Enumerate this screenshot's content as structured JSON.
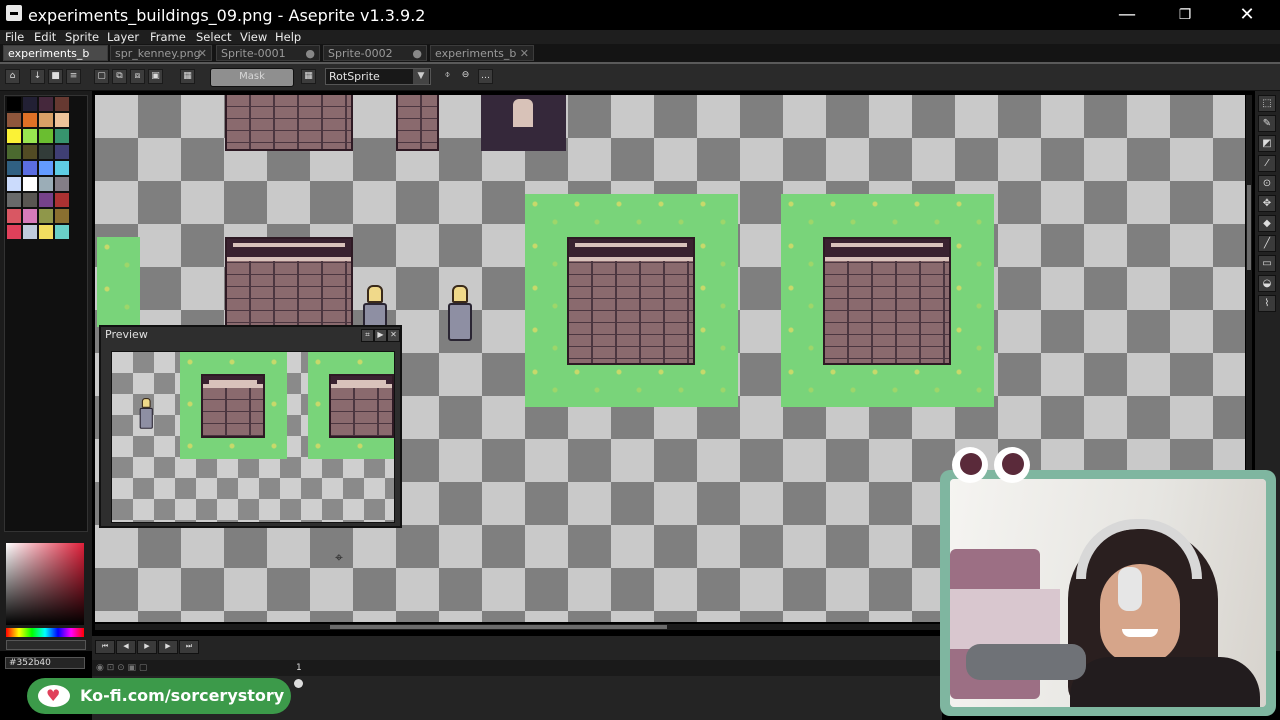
{
  "window": {
    "title": "experiments_buildings_09.png - Aseprite v1.3.9.2",
    "minimize": "—",
    "maximize": "❐",
    "close": "✕"
  },
  "menu": [
    "File",
    "Edit",
    "Sprite",
    "Layer",
    "Frame",
    "Select",
    "View",
    "Help"
  ],
  "tabs": [
    {
      "label": "experiments_b",
      "active": true
    },
    {
      "label": "spr_kenney.png",
      "active": false
    },
    {
      "label": "Sprite-0001",
      "active": false
    },
    {
      "label": "Sprite-0002",
      "active": false
    },
    {
      "label": "experiments_b",
      "active": false
    }
  ],
  "toolbar": {
    "mask_label": "Mask",
    "rotation_algorithm": "RotSprite"
  },
  "preview": {
    "title": "Preview"
  },
  "color": {
    "hex": "#352b40"
  },
  "palette": [
    "#000000",
    "#222034",
    "#45283c",
    "#663931",
    "#8f563b",
    "#df7126",
    "#d9a066",
    "#eec39a",
    "#fbf236",
    "#99e550",
    "#6abe30",
    "#37946e",
    "#4b692f",
    "#524b24",
    "#323c39",
    "#3f3f74",
    "#306082",
    "#5b6ee1",
    "#639bff",
    "#5fcde4",
    "#cbdbfc",
    "#ffffff",
    "#9badb7",
    "#847e87",
    "#696a6a",
    "#595652",
    "#76428a",
    "#ac3232",
    "#d95763",
    "#d77bba",
    "#8f974a",
    "#8a6f30",
    "#e0405a",
    "#c0cbdc",
    "#f2dd60",
    "#6ad0c8"
  ],
  "timeline": {
    "frame_number": "1"
  },
  "overlay": {
    "kofi_text": "Ko-fi.com/sorcerystory"
  },
  "icons": [
    "app-icon",
    "minimize-icon",
    "maximize-icon",
    "close-icon",
    "heart-icon"
  ]
}
